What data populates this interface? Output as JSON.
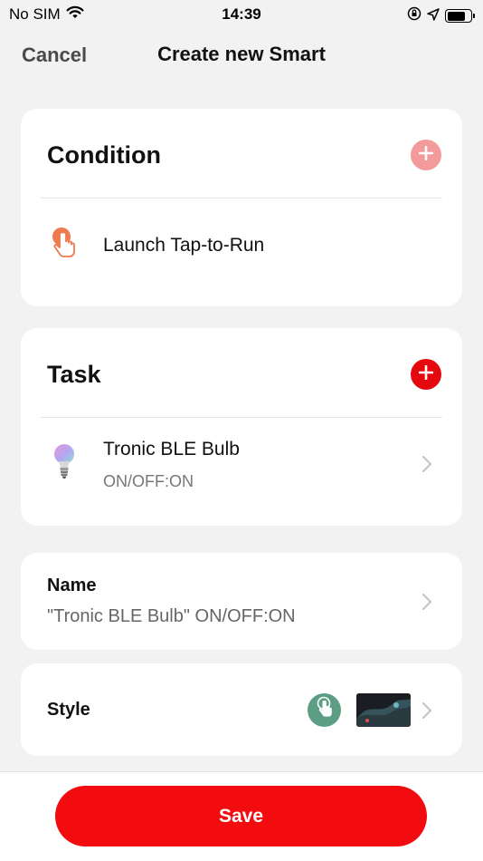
{
  "status_bar": {
    "carrier": "No SIM",
    "time": "14:39",
    "icons": [
      "wifi-icon",
      "orientation-lock-icon",
      "location-icon",
      "battery-icon"
    ]
  },
  "nav": {
    "cancel_label": "Cancel",
    "title": "Create new Smart"
  },
  "condition": {
    "title": "Condition",
    "add_icon": "plus-icon",
    "item": {
      "icon": "tap-hand-icon",
      "label": "Launch Tap-to-Run"
    }
  },
  "task": {
    "title": "Task",
    "add_icon": "plus-icon",
    "item": {
      "icon": "bulb-icon",
      "label": "Tronic BLE Bulb",
      "sub": "ON/OFF:ON"
    }
  },
  "name": {
    "title": "Name",
    "value": "\"Tronic BLE Bulb\" ON/OFF:ON"
  },
  "style": {
    "title": "Style",
    "icon": "tap-hand-icon",
    "thumbnail": "background-image-thumbnail"
  },
  "save_label": "Save",
  "colors": {
    "accent": "#f20c0f",
    "add_light": "#f39a9a",
    "add_strong": "#e5090f",
    "style_icon_bg": "#5b9e84",
    "background": "#f2f2f2"
  }
}
